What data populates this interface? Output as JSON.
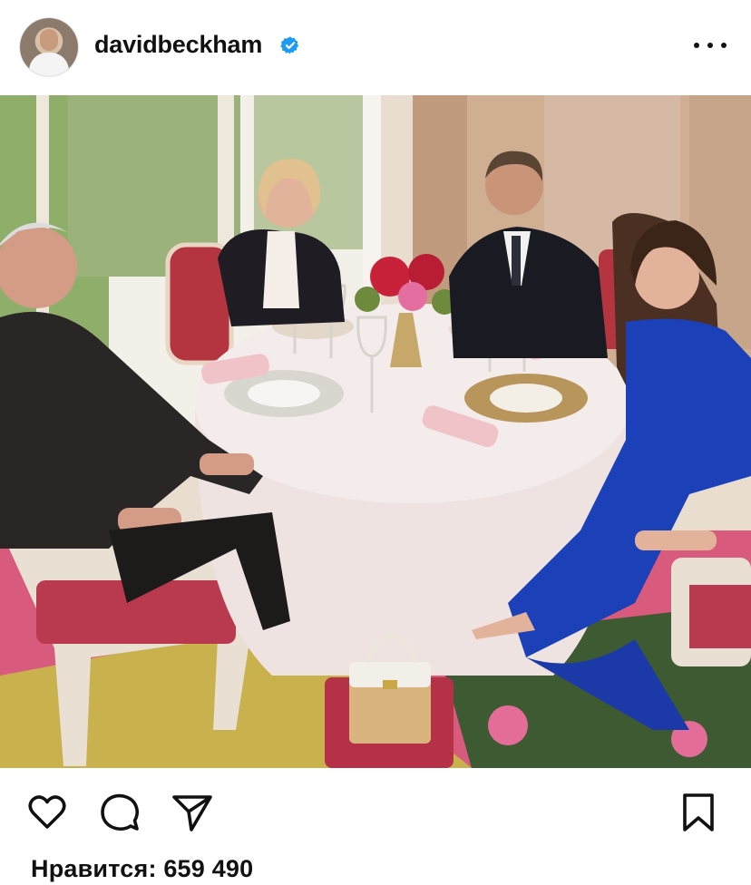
{
  "post": {
    "username": "davidbeckham",
    "verified": true,
    "likes_label": "Нравится:",
    "likes_count": "659 490"
  },
  "icons": {
    "like": "heart-icon",
    "comment": "comment-icon",
    "share": "send-icon",
    "save": "bookmark-icon",
    "more": "more-dots-icon",
    "verified": "verified-badge-icon"
  },
  "colors": {
    "verified_blue": "#1d9bf0",
    "text": "#111111"
  }
}
